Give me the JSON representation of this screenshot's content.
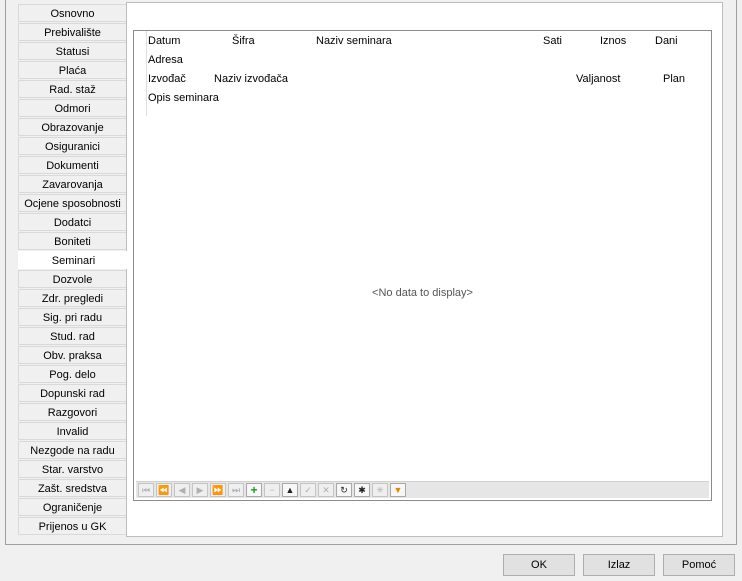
{
  "tabs": [
    {
      "label": "Osnovno"
    },
    {
      "label": "Prebivalište"
    },
    {
      "label": "Statusi"
    },
    {
      "label": "Plaća"
    },
    {
      "label": "Rad. staž"
    },
    {
      "label": "Odmori"
    },
    {
      "label": "Obrazovanje"
    },
    {
      "label": "Osiguranici"
    },
    {
      "label": "Dokumenti"
    },
    {
      "label": "Zavarovanja"
    },
    {
      "label": "Ocjene sposobnosti"
    },
    {
      "label": "Dodatci"
    },
    {
      "label": "Boniteti"
    },
    {
      "label": "Seminari",
      "active": true
    },
    {
      "label": "Dozvole"
    },
    {
      "label": "Zdr. pregledi"
    },
    {
      "label": "Sig. pri radu"
    },
    {
      "label": "Stud. rad"
    },
    {
      "label": "Obv. praksa"
    },
    {
      "label": "Pog. delo"
    },
    {
      "label": "Dopunski rad"
    },
    {
      "label": "Razgovori"
    },
    {
      "label": "Invalid"
    },
    {
      "label": "Nezgode na radu"
    },
    {
      "label": "Star. varstvo"
    },
    {
      "label": "Zašt. sredstva"
    },
    {
      "label": "Ograničenje"
    },
    {
      "label": "Prijenos u GK"
    }
  ],
  "grid": {
    "headers": {
      "datum": "Datum",
      "sifra": "Šifra",
      "naziv_seminara": "Naziv seminara",
      "sati": "Sati",
      "iznos": "Iznos",
      "dani": "Dani",
      "adresa": "Adresa",
      "izvodjac": "Izvođač",
      "naziv_izvodjaca": "Naziv izvođača",
      "valjanost": "Valjanost",
      "plan": "Plan",
      "opis_seminara": "Opis seminara"
    },
    "empty_text": "<No data to display>"
  },
  "navigator": [
    {
      "icon": "first-page-icon",
      "glyph": "⏮",
      "enabled": false
    },
    {
      "icon": "prev-page-icon",
      "glyph": "⏪",
      "enabled": false
    },
    {
      "icon": "prev-record-icon",
      "glyph": "◀",
      "enabled": false
    },
    {
      "icon": "next-record-icon",
      "glyph": "▶",
      "enabled": false
    },
    {
      "icon": "next-page-icon",
      "glyph": "⏩",
      "enabled": false
    },
    {
      "icon": "last-page-icon",
      "glyph": "⏭",
      "enabled": false
    },
    {
      "icon": "append-icon",
      "glyph": "+",
      "enabled": true
    },
    {
      "icon": "delete-icon",
      "glyph": "−",
      "enabled": false
    },
    {
      "icon": "edit-icon",
      "glyph": "▲",
      "enabled": true
    },
    {
      "icon": "post-icon",
      "glyph": "✓",
      "enabled": false
    },
    {
      "icon": "cancel-icon",
      "glyph": "✕",
      "enabled": false
    },
    {
      "icon": "refresh-icon",
      "glyph": "↻",
      "enabled": true
    },
    {
      "icon": "bookmark-icon",
      "glyph": "✱",
      "enabled": true
    },
    {
      "icon": "goto-bookmark-icon",
      "glyph": "✳",
      "enabled": false
    },
    {
      "icon": "filter-icon",
      "glyph": "▼",
      "enabled": true
    }
  ],
  "buttons": {
    "ok": "OK",
    "izlaz": "Izlaz",
    "pomoc": "Pomoć"
  }
}
